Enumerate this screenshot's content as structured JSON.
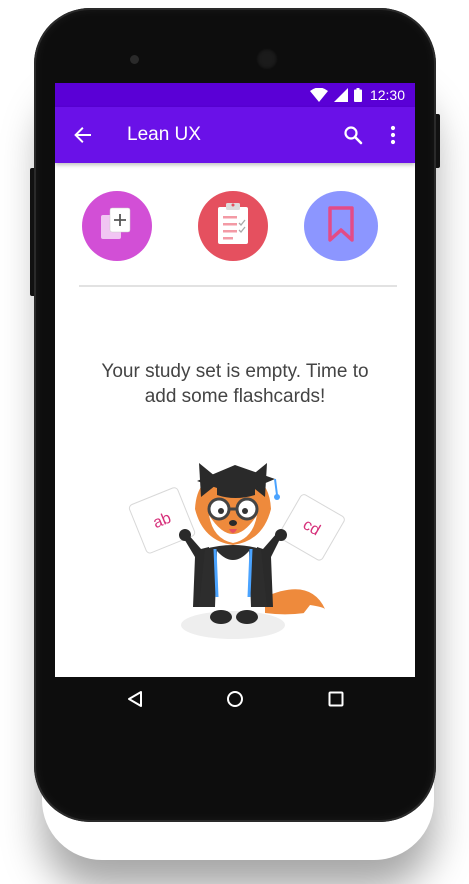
{
  "status_bar": {
    "time": "12:30",
    "icons": [
      "wifi-icon",
      "signal-icon",
      "battery-icon"
    ]
  },
  "app_bar": {
    "title": "Lean UX",
    "back_icon": "arrow-back-icon",
    "search_icon": "search-icon",
    "more_icon": "more-vert-icon"
  },
  "actions": [
    {
      "name": "add-flashcards",
      "icon": "add-cards-icon",
      "color": "#d24fd6"
    },
    {
      "name": "quiz",
      "icon": "clipboard-icon",
      "color": "#e5505f"
    },
    {
      "name": "bookmarks",
      "icon": "bookmark-icon",
      "color": "#8c96ff"
    }
  ],
  "empty_state": {
    "message": "Your study set is empty. Time to add some flashcards!",
    "card_left": "ab",
    "card_right": "cd"
  },
  "nav_bar": {
    "icons": [
      "back-triangle-icon",
      "home-circle-icon",
      "recents-square-icon"
    ]
  },
  "colors": {
    "status_bar": "#5a00d6",
    "app_bar": "#6a11e8",
    "text": "#444444",
    "card_text": "#d6307a"
  }
}
